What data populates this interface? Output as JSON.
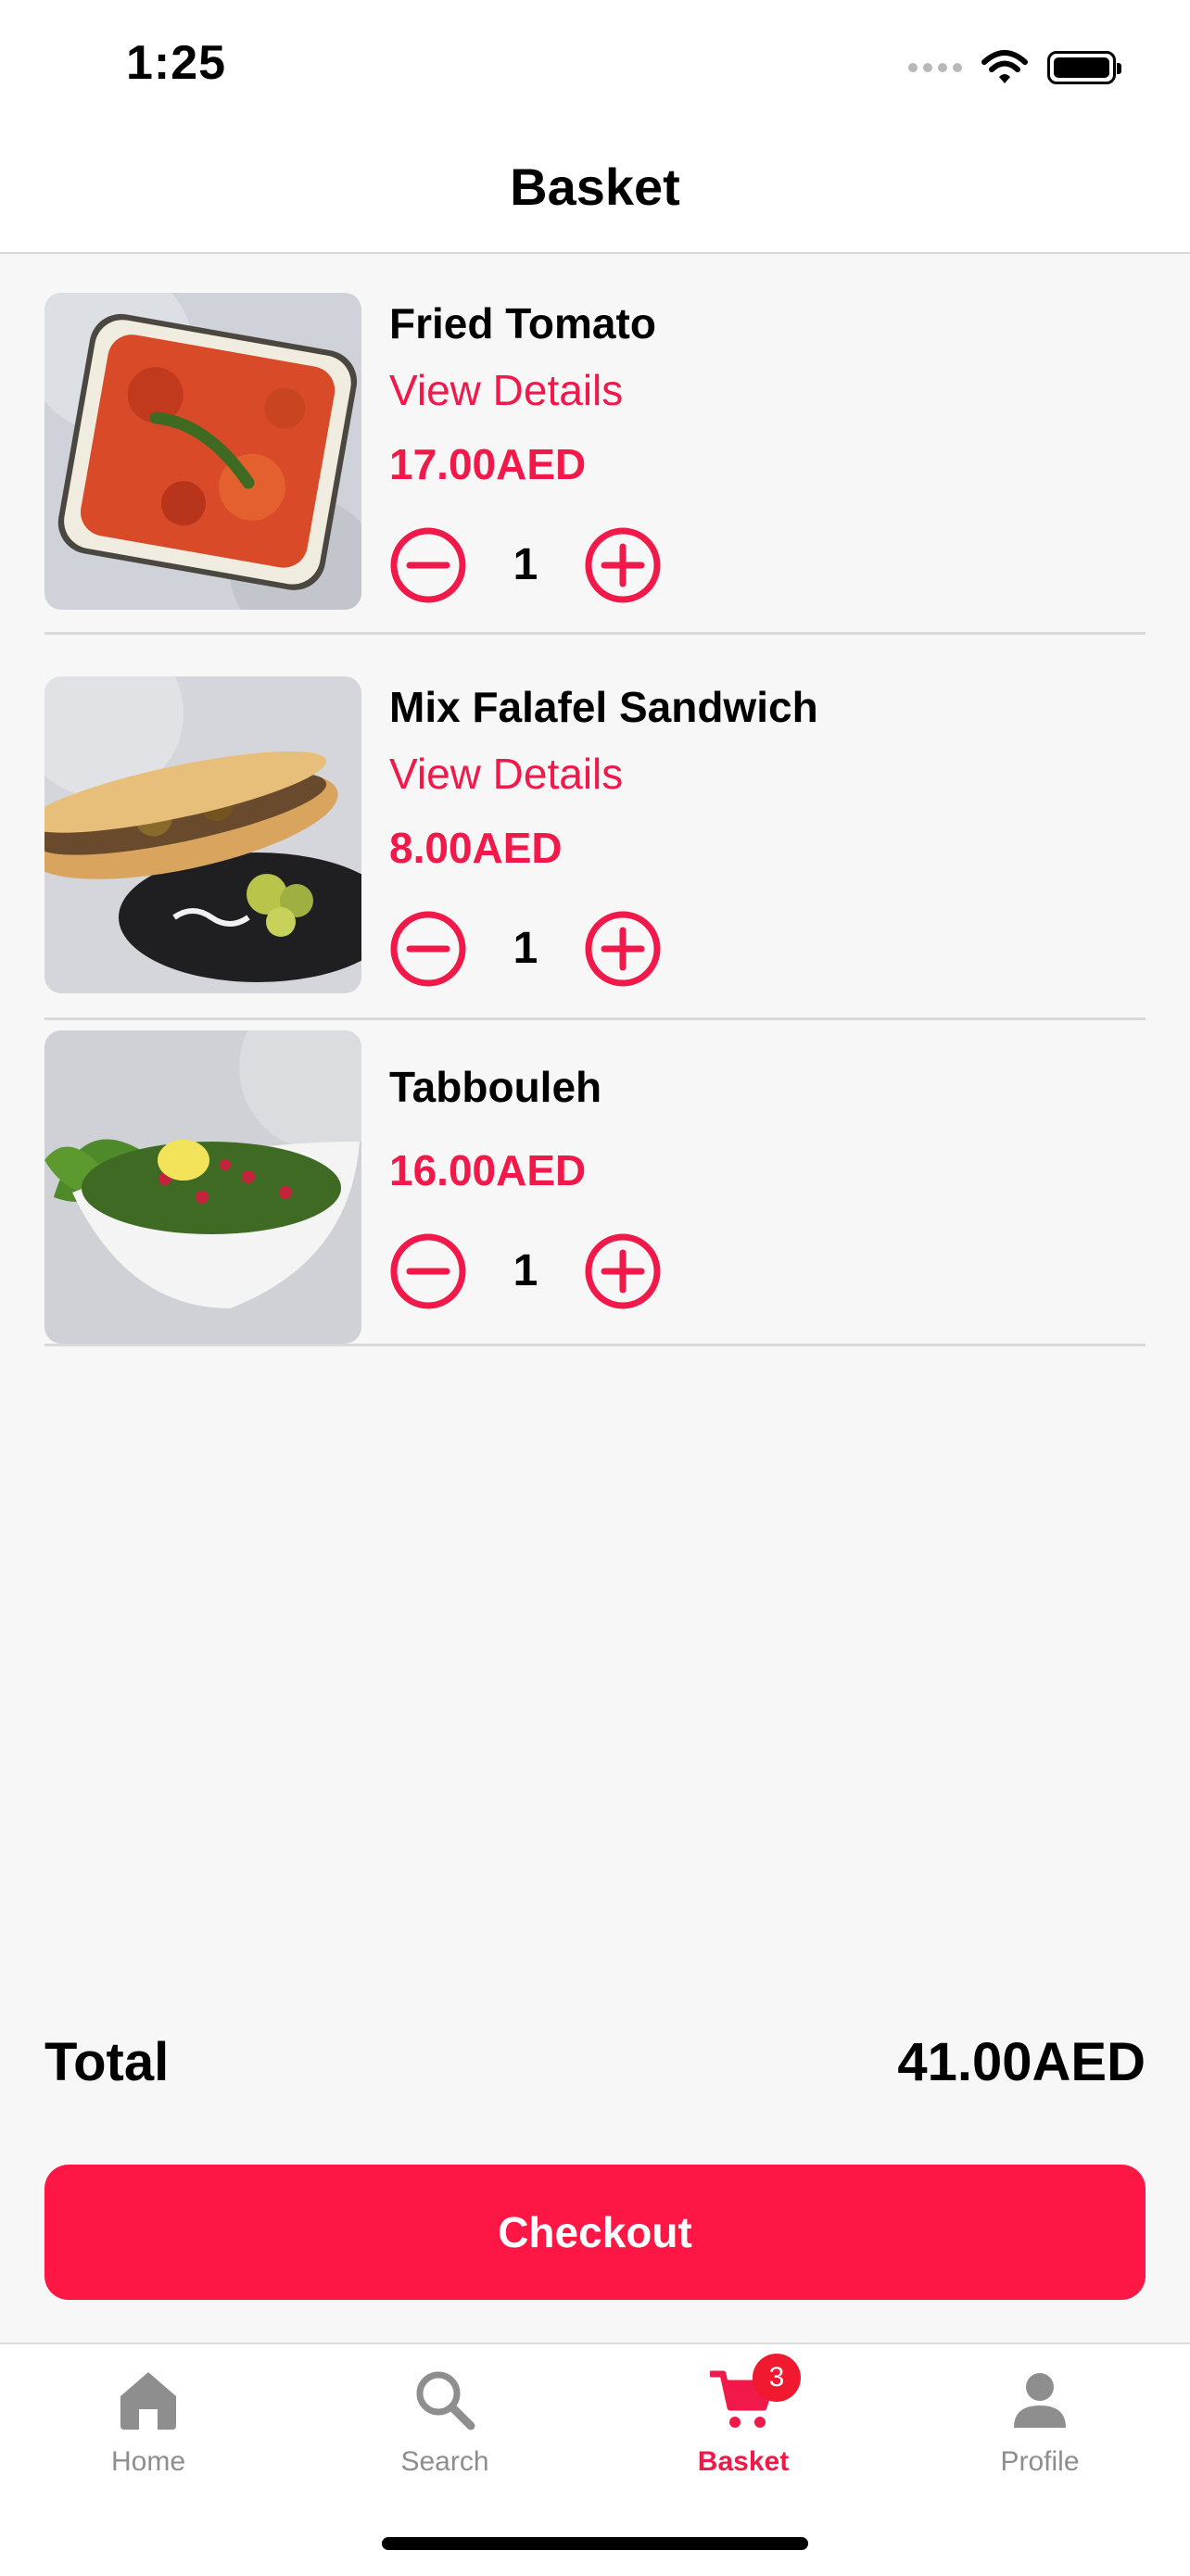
{
  "status_bar": {
    "time": "1:25"
  },
  "header": {
    "title": "Basket"
  },
  "items": [
    {
      "name": "Fried Tomato",
      "details_link": "View Details",
      "price": "17.00AED",
      "quantity": "1"
    },
    {
      "name": "Mix Falafel Sandwich",
      "details_link": "View Details",
      "price": "8.00AED",
      "quantity": "1"
    },
    {
      "name": "Tabbouleh",
      "price": "16.00AED",
      "quantity": "1"
    }
  ],
  "summary": {
    "total_label": "Total",
    "total_value": "41.00AED"
  },
  "checkout": {
    "label": "Checkout"
  },
  "tabs": [
    {
      "label": "Home",
      "icon": "home-icon"
    },
    {
      "label": "Search",
      "icon": "search-icon"
    },
    {
      "label": "Basket",
      "icon": "cart-icon",
      "badge": "3",
      "active": true
    },
    {
      "label": "Profile",
      "icon": "profile-icon"
    }
  ],
  "colors": {
    "accent": "#f0194a",
    "checkout": "#fe1645",
    "badge": "#f0192f",
    "inactive_tab": "#8e8e8e"
  }
}
